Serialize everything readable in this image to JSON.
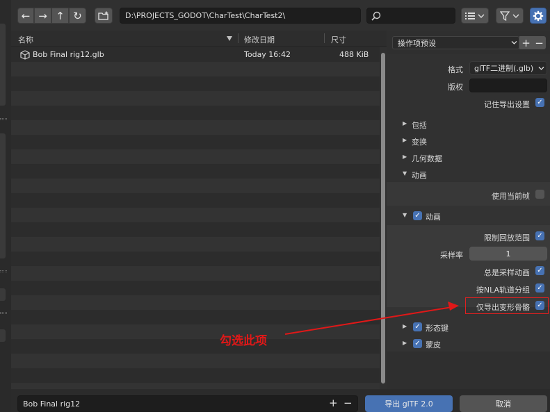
{
  "toolbar": {
    "back_icon": "←",
    "forward_icon": "→",
    "parent_icon": "↑",
    "refresh_icon": "↻",
    "new_folder_icon": "new-folder",
    "path": "D:\\PROJECTS_GODOT\\CharTest\\CharTest2\\",
    "search_placeholder": "",
    "display_mode_icon": "list",
    "filter_icon": "filter",
    "settings_icon": "gear",
    "accent_color": "#4772b3"
  },
  "file_list": {
    "columns": [
      "名称",
      "修改日期",
      "尺寸"
    ],
    "files": [
      {
        "name": "Bob Final rig12.glb",
        "date": "Today 16:42",
        "size": "488 KiB"
      }
    ]
  },
  "options": {
    "preset_label": "操作项预设",
    "format_label": "格式",
    "format_value": "glTF二进制(.glb)",
    "copyright_label": "版权",
    "copyright_value": "",
    "remember_label": "记住导出设置",
    "sections": {
      "include": "包括",
      "transform": "变换",
      "geometry": "几何数据",
      "animation": "动画"
    },
    "use_current_frame": "使用当前帧",
    "animation_sub": "动画",
    "limit_playback": "限制回放范围",
    "sampling_rate_label": "采样率",
    "sampling_rate_value": "1",
    "always_sample": "总是采样动画",
    "group_by_nla": "按NLA轨道分组",
    "export_deform_bones": "仅导出变形骨骼",
    "shape_keys": "形态键",
    "skinning": "蒙皮"
  },
  "bottom": {
    "filename": "Bob Final rig12",
    "export_button": "导出 glTF 2.0",
    "cancel_button": "取消"
  },
  "annotation": {
    "text": "勾选此项",
    "color": "#e11818"
  }
}
